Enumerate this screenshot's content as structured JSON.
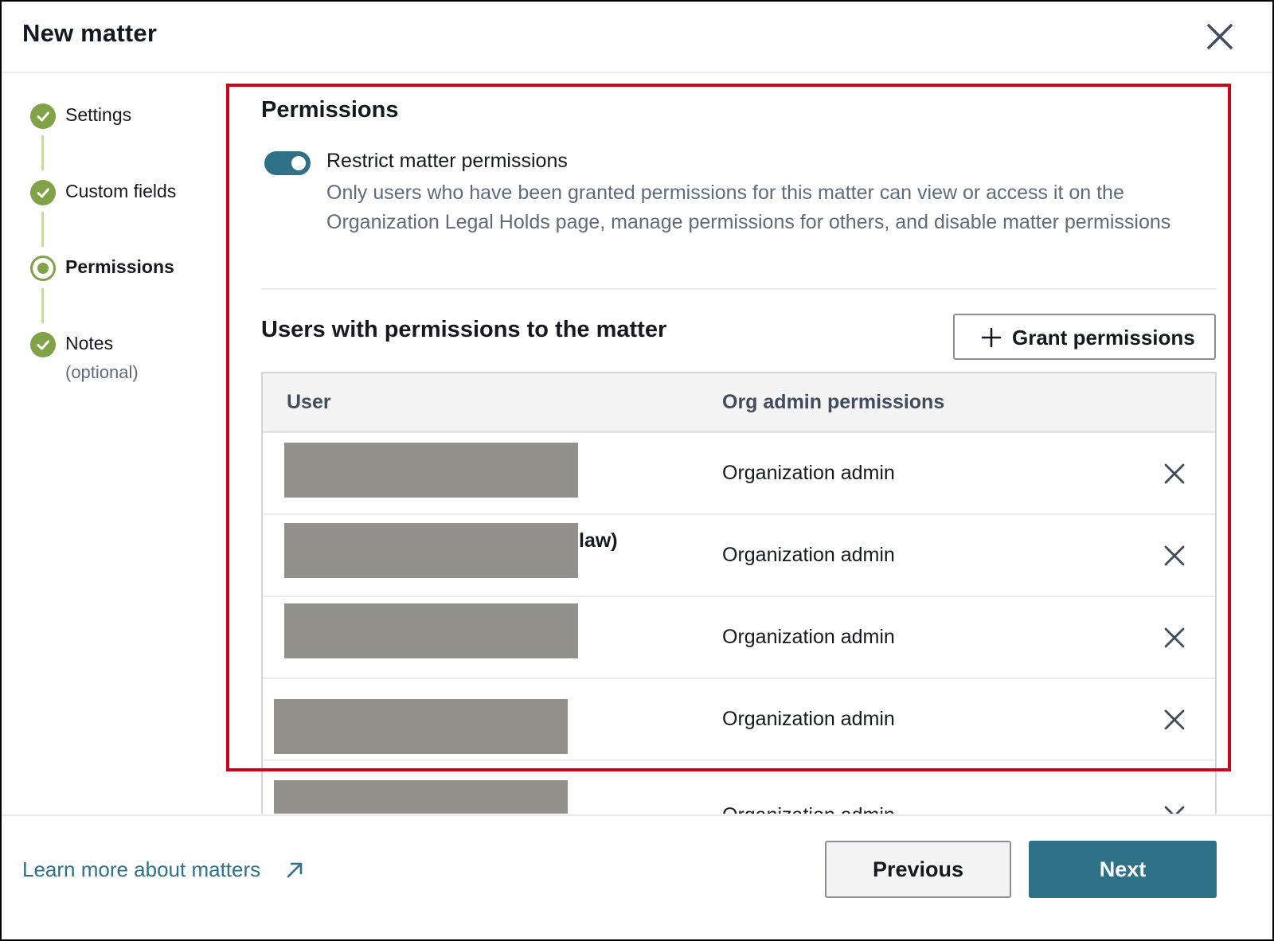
{
  "dialog": {
    "title": "New matter",
    "close_icon": "close-icon"
  },
  "steps": [
    {
      "label": "Settings",
      "status": "complete"
    },
    {
      "label": "Custom fields",
      "status": "complete"
    },
    {
      "label": "Permissions",
      "status": "current"
    },
    {
      "label": "Notes",
      "sublabel": "(optional)",
      "status": "complete"
    }
  ],
  "permissions": {
    "title": "Permissions",
    "toggle": {
      "label": "Restrict matter permissions",
      "checked": true,
      "description": "Only users who have been granted permissions for this matter can view or access it on the Organization Legal Holds page, manage permissions for others, and disable matter permissions"
    },
    "users_title": "Users with permissions to the matter",
    "grant_button": "Grant permissions",
    "table": {
      "headers": [
        "User",
        "Org admin permissions"
      ],
      "rows": [
        {
          "user_visible": "",
          "permission": "Organization admin"
        },
        {
          "user_visible": "law)",
          "permission": "Organization admin"
        },
        {
          "user_visible": "",
          "permission": "Organization admin"
        },
        {
          "user_visible": "",
          "permission": "Organization admin"
        },
        {
          "user_visible": "",
          "permission": "Organization admin"
        }
      ]
    }
  },
  "footer": {
    "learn_more": "Learn more about matters",
    "previous": "Previous",
    "next": "Next"
  },
  "colors": {
    "accent": "#2f7186",
    "step_complete": "#7fa346",
    "highlight": "#d0021b",
    "redaction": "#92918c"
  }
}
